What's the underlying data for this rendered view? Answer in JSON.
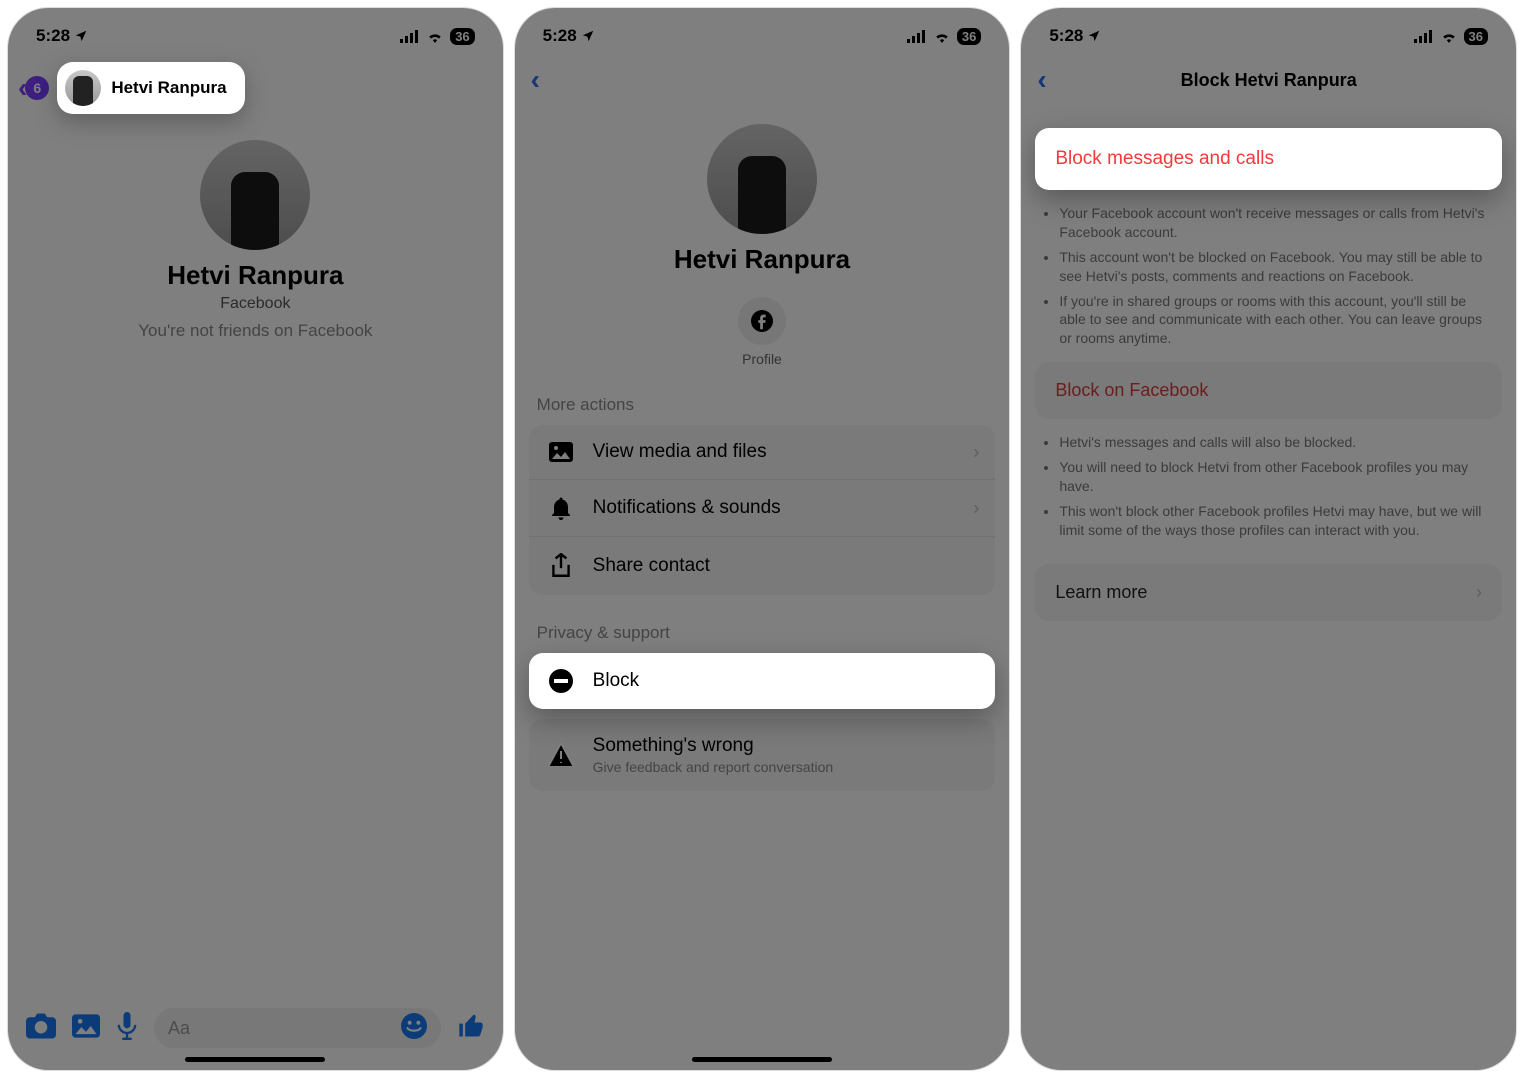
{
  "status": {
    "time": "5:28",
    "battery": "36"
  },
  "contact_name": "Hetvi Ranpura",
  "screen1": {
    "badge_count": "6",
    "subtitle1": "Facebook",
    "subtitle2": "You're not friends on Facebook",
    "input_placeholder": "Aa"
  },
  "screen2": {
    "profile_chip": "Profile",
    "more_actions": "More actions",
    "rows": {
      "media": "View media and files",
      "notifs": "Notifications & sounds",
      "share": "Share contact"
    },
    "privacy_label": "Privacy & support",
    "block": "Block",
    "wrong": "Something's wrong",
    "wrong_sub": "Give feedback and report conversation"
  },
  "screen3": {
    "title": "Block Hetvi Ranpura",
    "block_msgs": "Block messages and calls",
    "bullets1": [
      "Your Facebook account won't receive messages or calls from Hetvi's Facebook account.",
      "This account won't be blocked on Facebook. You may still be able to see Hetvi's posts, comments and reactions on Facebook.",
      "If you're in shared groups or rooms with this account, you'll still be able to see and communicate with each other. You can leave groups or rooms anytime."
    ],
    "block_fb": "Block on Facebook",
    "bullets2": [
      "Hetvi's messages and calls will also be blocked.",
      "You will need to block Hetvi from other Facebook profiles you may have.",
      "This won't block other Facebook profiles Hetvi may have, but we will limit some of the ways those profiles can interact with you."
    ],
    "learn_more": "Learn more"
  }
}
